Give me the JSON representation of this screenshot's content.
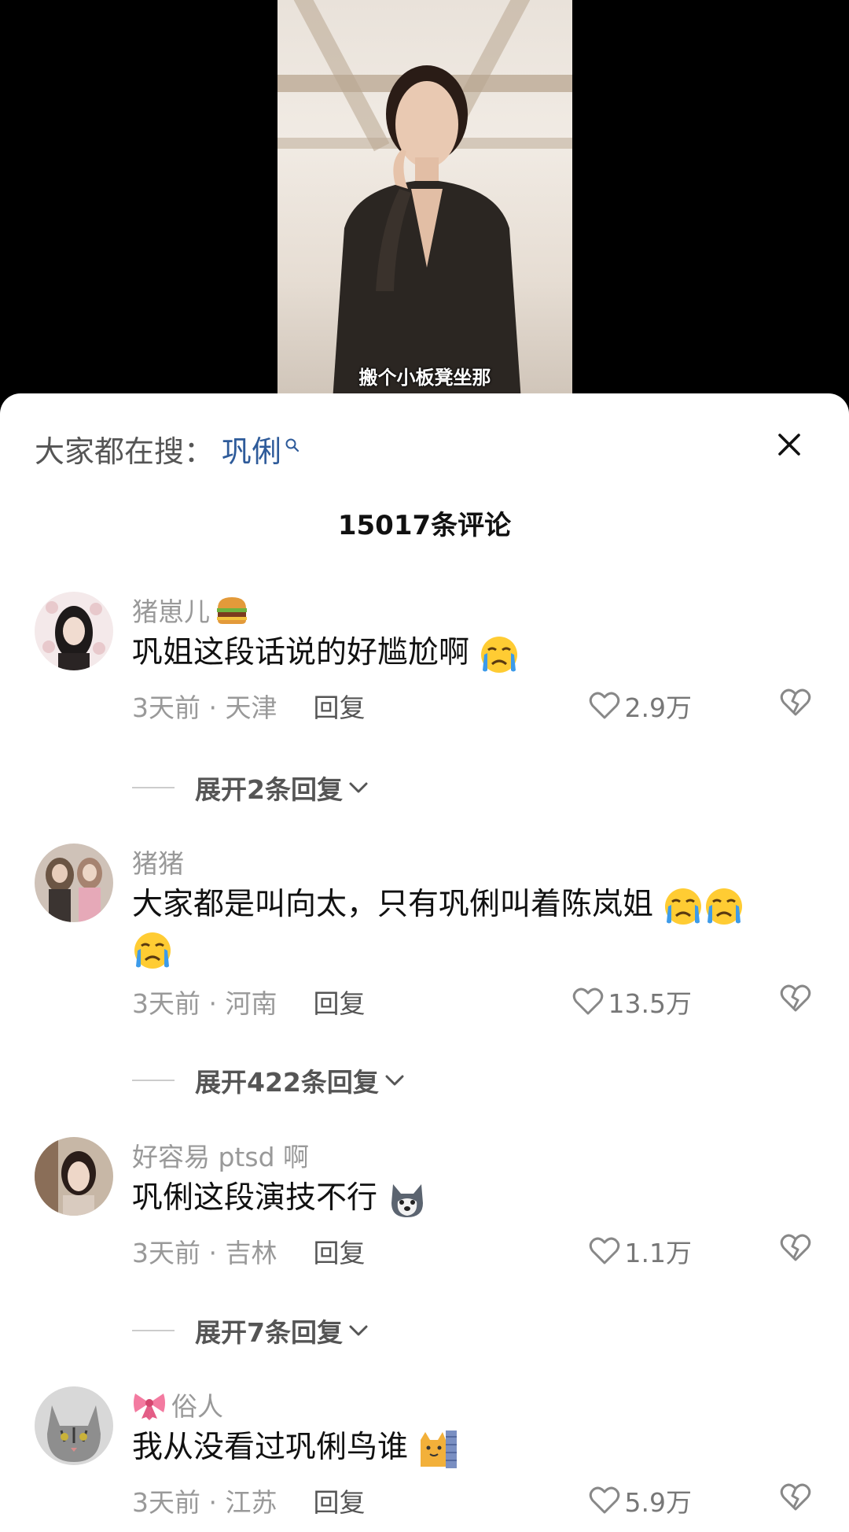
{
  "video": {
    "caption": "搬个小板凳坐那"
  },
  "sheet": {
    "search_prefix": "大家都在搜：",
    "search_term": "巩俐",
    "comment_count": "15017条评论"
  },
  "comments": [
    {
      "username": "猪崽儿",
      "text": "巩姐这段话说的好尴尬啊",
      "time_location": "3天前 · 天津",
      "reply_label": "回复",
      "likes": "2.9万",
      "expand_label": "展开2条回复"
    },
    {
      "username": "猪猪",
      "text": "大家都是叫向太，只有巩俐叫着陈岚姐",
      "time_location": "3天前 · 河南",
      "reply_label": "回复",
      "likes": "13.5万",
      "expand_label": "展开422条回复"
    },
    {
      "username": "好容易 ptsd 啊",
      "text": "巩俐这段演技不行",
      "time_location": "3天前 · 吉林",
      "reply_label": "回复",
      "likes": "1.1万",
      "expand_label": "展开7条回复"
    },
    {
      "username": "俗人",
      "text": "我从没看过巩俐鸟谁",
      "time_location": "3天前 · 江苏",
      "reply_label": "回复",
      "likes": "5.9万"
    }
  ],
  "colors": {
    "accent_link": "#2e5b9a",
    "muted_text": "#999999",
    "body_text": "#111111",
    "sheet_bg": "#ffffff"
  }
}
